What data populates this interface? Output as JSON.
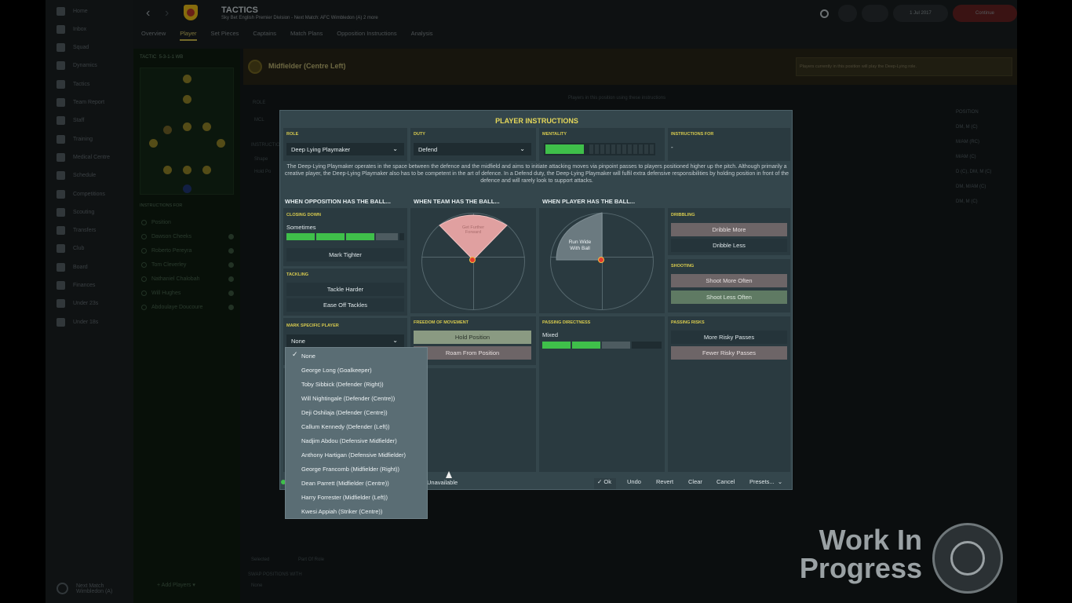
{
  "sidebar": {
    "items": [
      "Home",
      "Inbox",
      "Squad",
      "Dynamics",
      "Tactics",
      "Team Report",
      "Staff",
      "Training",
      "Medical Centre",
      "Schedule",
      "Competitions",
      "Scouting",
      "Transfers",
      "Club",
      "Board",
      "Finances",
      "Under 23s",
      "Under 18s"
    ],
    "footer": "Next Match\nWimbledon (A)"
  },
  "header": {
    "title": "TACTICS",
    "subtitle": "Sky Bet English Premier Division - Next Match: AFC Wimbledon (A) 2 more",
    "tabs": [
      "Overview",
      "Player",
      "Set Pieces",
      "Captains",
      "Match Plans",
      "Opposition Instructions",
      "Analysis"
    ],
    "active_tab": "Player",
    "date": "1 Jul 2017",
    "continue": "Continue"
  },
  "position_bar": {
    "label": "Midfielder (Centre Left)",
    "message": "Players currently in this position will play the Deep-Lying role."
  },
  "left_panel": {
    "tactic_label": "TACTIC",
    "tactic_value": "5-3-1-1 WB",
    "instructions_for": "INSTRUCTIONS FOR",
    "position": "Position",
    "players": [
      "Dawson Cheeks",
      "Roberto Pereyra",
      "Tom Cleverley",
      "Nathaniel Chalobah",
      "Will Hughes",
      "Abdoulaye Doucoure"
    ],
    "add_players": "Add Players"
  },
  "background_right": {
    "header": "Players in this position using these instructions",
    "position_col": "POSITION",
    "positions": [
      "DM, M (C)",
      "M/AM (RC)",
      "M/AM (C)",
      "D (C), DM, M (C)",
      "DM, M/AM (C)",
      "DM, M (C)"
    ],
    "selected": "Selected",
    "part_of_role": "Part Of Role",
    "swap_label": "SWAP POSITIONS WITH",
    "swap_value": "None",
    "role_label": "ROLE",
    "role_value": "MCL",
    "instructions_label": "INSTRUCTIONS",
    "shape_label": "Shape",
    "hold_label": "Hold Po"
  },
  "modal": {
    "title": "PLAYER INSTRUCTIONS",
    "role_label": "ROLE",
    "role_value": "Deep Lying Playmaker",
    "duty_label": "DUTY",
    "duty_value": "Defend",
    "mentality_label": "MENTALITY",
    "mentality_level": 0.35,
    "instructions_for_label": "INSTRUCTIONS FOR",
    "instructions_for_value": "-",
    "description": "The Deep-Lying Playmaker operates in the space between the defence and the midfield and aims to initiate attacking moves via pinpoint passes to players positioned higher up the pitch. Although primarily a creative player, the Deep-Lying Playmaker also has to be competent in the art of defence. In a Defend duty, the Deep-Lying Playmaker will fulfil extra defensive responsibilities by holding position in front of the defence and will rarely look to support attacks.",
    "col1_title": "WHEN OPPOSITION HAS THE BALL...",
    "col2_title": "WHEN TEAM HAS THE BALL...",
    "col3_title": "WHEN PLAYER HAS THE BALL...",
    "closing_down_label": "CLOSING DOWN",
    "closing_down_value": "Sometimes",
    "mark_tighter": "Mark Tighter",
    "tackling_label": "TACKLING",
    "tackle_harder": "Tackle Harder",
    "ease_off": "Ease Off Tackles",
    "mark_specific_label": "MARK SPECIFIC PLAYER",
    "mark_specific_value": "None",
    "get_further_forward": "Get Further Forward",
    "run_wide": "Run Wide With Ball",
    "freedom_label": "FREEDOM OF MOVEMENT",
    "hold_position": "Hold Position",
    "roam": "Roam From Position",
    "passing_directness_label": "PASSING DIRECTNESS",
    "passing_directness_value": "Mixed",
    "dribbling_label": "DRIBBLING",
    "dribble_more": "Dribble More",
    "dribble_less": "Dribble Less",
    "shooting_label": "SHOOTING",
    "shoot_more": "Shoot More Often",
    "shoot_less": "Shoot Less Often",
    "passing_risks_label": "PASSING RISKS",
    "more_risky": "More Risky Passes",
    "fewer_risky": "Fewer Risky Passes",
    "unavailable": "Unavailable",
    "ok": "Ok",
    "undo": "Undo",
    "revert": "Revert",
    "clear": "Clear",
    "cancel": "Cancel",
    "presets": "Presets..."
  },
  "dropdown": {
    "items": [
      "None",
      "George Long (Goalkeeper)",
      "Toby Sibbick (Defender (Right))",
      "Will Nightingale (Defender (Centre))",
      "Deji Oshilaja (Defender (Centre))",
      "Callum Kennedy (Defender (Left))",
      "Nadjim Abdou (Defensive Midfielder)",
      "Anthony Hartigan (Defensive Midfielder)",
      "George Francomb (Midfielder (Right))",
      "Dean Parrett (Midfielder (Centre))",
      "Harry Forrester (Midfielder (Left))",
      "Kwesi Appiah (Striker (Centre))"
    ],
    "selected_index": 0
  },
  "watermark": {
    "line1": "Work In",
    "line2": "Progress"
  }
}
